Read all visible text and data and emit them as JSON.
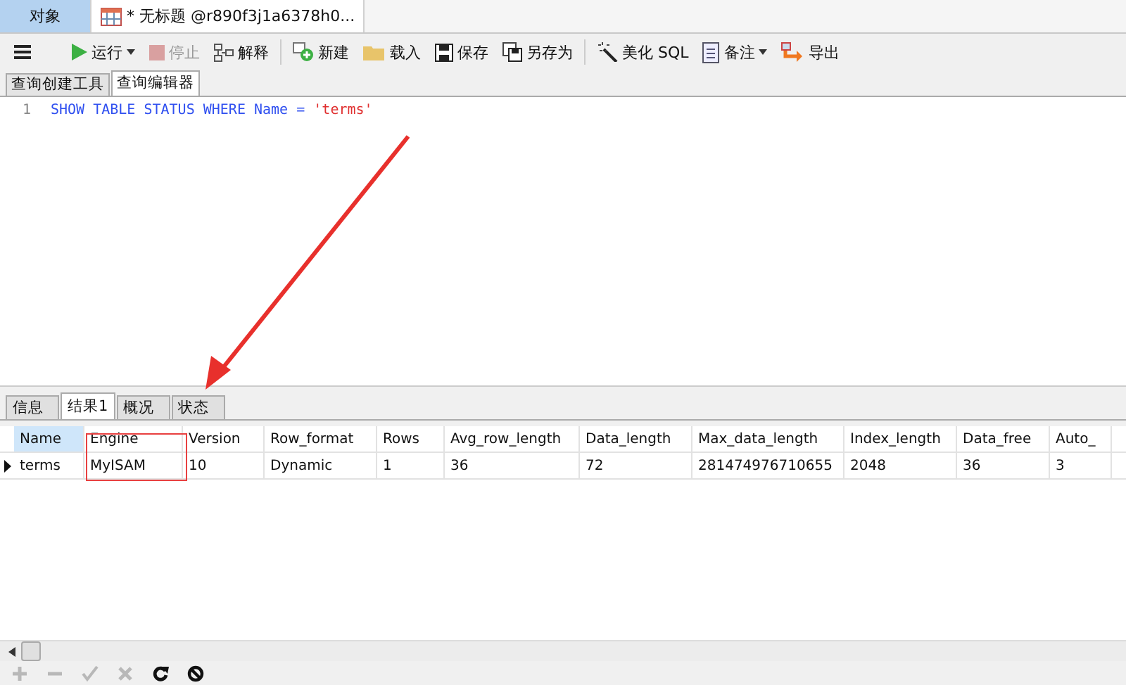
{
  "tabs": [
    {
      "label": "对象",
      "selected": false,
      "kind": "plain"
    },
    {
      "label": "* 无标题 @r890f3j1a6378h0...",
      "selected": true,
      "kind": "query"
    }
  ],
  "toolbar": [
    {
      "kind": "menu"
    },
    {
      "kind": "run",
      "label": "运行",
      "disabled": false,
      "dropdown": true
    },
    {
      "kind": "stop",
      "label": "停止",
      "disabled": true
    },
    {
      "kind": "explain",
      "label": "解释",
      "disabled": false
    },
    {
      "kind": "separator"
    },
    {
      "kind": "new",
      "label": "新建",
      "disabled": false
    },
    {
      "kind": "load",
      "label": "载入",
      "disabled": false
    },
    {
      "kind": "save",
      "label": "保存",
      "disabled": false
    },
    {
      "kind": "saveas",
      "label": "另存为",
      "disabled": false
    },
    {
      "kind": "separator"
    },
    {
      "kind": "beautify",
      "label": "美化 SQL",
      "disabled": false
    },
    {
      "kind": "note",
      "label": "备注",
      "disabled": false,
      "dropdown": true
    },
    {
      "kind": "export",
      "label": "导出",
      "disabled": false
    }
  ],
  "editor_tabs": [
    {
      "label": "查询创建工具",
      "selected": false
    },
    {
      "label": "查询编辑器",
      "selected": true
    }
  ],
  "editor": {
    "lines": [
      {
        "number": "1",
        "tokens": [
          {
            "text": "SHOW TABLE STATUS WHERE Name =",
            "kind": "keyword"
          },
          {
            "text": "'terms'",
            "kind": "string"
          }
        ]
      }
    ]
  },
  "result_tabs": [
    {
      "label": "信息",
      "selected": false
    },
    {
      "label": "结果1",
      "selected": true
    },
    {
      "label": "概况",
      "selected": false
    },
    {
      "label": "状态",
      "selected": false
    }
  ],
  "table": {
    "columns": [
      {
        "label": "Name",
        "selected": true
      },
      {
        "label": "Engine",
        "selected": false
      },
      {
        "label": "Version",
        "selected": false
      },
      {
        "label": "Row_format",
        "selected": false
      },
      {
        "label": "Rows",
        "selected": false
      },
      {
        "label": "Avg_row_length",
        "selected": false
      },
      {
        "label": "Data_length",
        "selected": false
      },
      {
        "label": "Max_data_length",
        "selected": false
      },
      {
        "label": "Index_length",
        "selected": false
      },
      {
        "label": "Data_free",
        "selected": false
      },
      {
        "label": "Auto_",
        "selected": false
      }
    ],
    "rows": [
      {
        "selected": true,
        "cells": [
          "terms",
          "MyISAM",
          "10",
          "Dynamic",
          "1",
          "36",
          "72",
          "281474976710655",
          "2048",
          "36",
          "3"
        ]
      }
    ]
  },
  "bottom_tools": [
    {
      "kind": "add",
      "disabled": true
    },
    {
      "kind": "remove",
      "disabled": true
    },
    {
      "kind": "apply",
      "disabled": true
    },
    {
      "kind": "cancel",
      "disabled": true
    },
    {
      "kind": "refresh",
      "disabled": false
    },
    {
      "kind": "stop",
      "disabled": false
    }
  ],
  "annotation": {
    "kind": "arrow-box"
  }
}
